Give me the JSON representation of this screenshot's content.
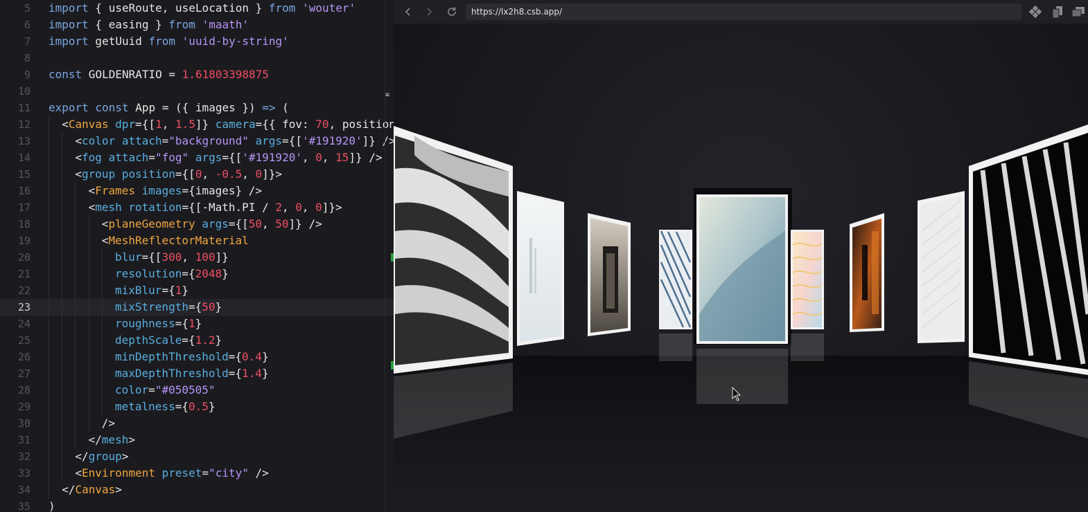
{
  "editor": {
    "current_line": 23,
    "lines": [
      {
        "n": 5,
        "indent": 0,
        "tokens": [
          [
            "k",
            "import"
          ],
          [
            "p",
            " { useRoute, useLocation } "
          ],
          [
            "k",
            "from"
          ],
          [
            "p",
            " "
          ],
          [
            "s",
            "'wouter'"
          ]
        ]
      },
      {
        "n": 6,
        "indent": 0,
        "tokens": [
          [
            "k",
            "import"
          ],
          [
            "p",
            " { easing } "
          ],
          [
            "k",
            "from"
          ],
          [
            "p",
            " "
          ],
          [
            "s",
            "'maath'"
          ]
        ]
      },
      {
        "n": 7,
        "indent": 0,
        "tokens": [
          [
            "k",
            "import"
          ],
          [
            "p",
            " getUuid "
          ],
          [
            "k",
            "from"
          ],
          [
            "p",
            " "
          ],
          [
            "s",
            "'uuid-by-string'"
          ]
        ]
      },
      {
        "n": 8,
        "indent": 0,
        "tokens": []
      },
      {
        "n": 9,
        "indent": 0,
        "tokens": [
          [
            "k",
            "const"
          ],
          [
            "p",
            " GOLDENRATIO = "
          ],
          [
            "n",
            "1.61803398875"
          ]
        ]
      },
      {
        "n": 10,
        "indent": 0,
        "tokens": []
      },
      {
        "n": 11,
        "indent": 0,
        "tokens": [
          [
            "k",
            "export const"
          ],
          [
            "p",
            " App = ({ images }) "
          ],
          [
            "k",
            "=>"
          ],
          [
            "p",
            " ("
          ]
        ]
      },
      {
        "n": 12,
        "indent": 1,
        "tokens": [
          [
            "p",
            "<"
          ],
          [
            "t",
            "Canvas"
          ],
          [
            "p",
            " "
          ],
          [
            "a",
            "dpr"
          ],
          [
            "p",
            "={["
          ],
          [
            "n",
            "1"
          ],
          [
            "p",
            ", "
          ],
          [
            "n",
            "1.5"
          ],
          [
            "p",
            "]} "
          ],
          [
            "a",
            "camera"
          ],
          [
            "p",
            "={{ fov: "
          ],
          [
            "n",
            "70"
          ],
          [
            "p",
            ", position"
          ]
        ]
      },
      {
        "n": 13,
        "indent": 2,
        "tokens": [
          [
            "p",
            "<"
          ],
          [
            "a",
            "color"
          ],
          [
            "p",
            " "
          ],
          [
            "a",
            "attach"
          ],
          [
            "p",
            "="
          ],
          [
            "s",
            "\"background\""
          ],
          [
            "p",
            " "
          ],
          [
            "a",
            "args"
          ],
          [
            "p",
            "={["
          ],
          [
            "s",
            "'#191920'"
          ],
          [
            "p",
            "]} />"
          ]
        ]
      },
      {
        "n": 14,
        "indent": 2,
        "tokens": [
          [
            "p",
            "<"
          ],
          [
            "a",
            "fog"
          ],
          [
            "p",
            " "
          ],
          [
            "a",
            "attach"
          ],
          [
            "p",
            "="
          ],
          [
            "s",
            "\"fog\""
          ],
          [
            "p",
            " "
          ],
          [
            "a",
            "args"
          ],
          [
            "p",
            "={["
          ],
          [
            "s",
            "'#191920'"
          ],
          [
            "p",
            ", "
          ],
          [
            "n",
            "0"
          ],
          [
            "p",
            ", "
          ],
          [
            "n",
            "15"
          ],
          [
            "p",
            "]} />"
          ]
        ]
      },
      {
        "n": 15,
        "indent": 2,
        "tokens": [
          [
            "p",
            "<"
          ],
          [
            "a",
            "group"
          ],
          [
            "p",
            " "
          ],
          [
            "a",
            "position"
          ],
          [
            "p",
            "={["
          ],
          [
            "n",
            "0"
          ],
          [
            "p",
            ", "
          ],
          [
            "n",
            "-0.5"
          ],
          [
            "p",
            ", "
          ],
          [
            "n",
            "0"
          ],
          [
            "p",
            "]}>"
          ]
        ]
      },
      {
        "n": 16,
        "indent": 3,
        "tokens": [
          [
            "p",
            "<"
          ],
          [
            "t",
            "Frames"
          ],
          [
            "p",
            " "
          ],
          [
            "a",
            "images"
          ],
          [
            "p",
            "={images} />"
          ]
        ]
      },
      {
        "n": 17,
        "indent": 3,
        "tokens": [
          [
            "p",
            "<"
          ],
          [
            "a",
            "mesh"
          ],
          [
            "p",
            " "
          ],
          [
            "a",
            "rotation"
          ],
          [
            "p",
            "={[-Math.PI / "
          ],
          [
            "n",
            "2"
          ],
          [
            "p",
            ", "
          ],
          [
            "n",
            "0"
          ],
          [
            "p",
            ", "
          ],
          [
            "n",
            "0"
          ],
          [
            "p",
            "]}>"
          ]
        ]
      },
      {
        "n": 18,
        "indent": 4,
        "tokens": [
          [
            "p",
            "<"
          ],
          [
            "t",
            "planeGeometry"
          ],
          [
            "p",
            " "
          ],
          [
            "a",
            "args"
          ],
          [
            "p",
            "={["
          ],
          [
            "n",
            "50"
          ],
          [
            "p",
            ", "
          ],
          [
            "n",
            "50"
          ],
          [
            "p",
            "]} />"
          ]
        ]
      },
      {
        "n": 19,
        "indent": 4,
        "tokens": [
          [
            "p",
            "<"
          ],
          [
            "t",
            "MeshReflectorMaterial"
          ]
        ]
      },
      {
        "n": 20,
        "indent": 5,
        "tokens": [
          [
            "a",
            "blur"
          ],
          [
            "p",
            "={["
          ],
          [
            "n",
            "300"
          ],
          [
            "p",
            ", "
          ],
          [
            "n",
            "100"
          ],
          [
            "p",
            "]}"
          ]
        ]
      },
      {
        "n": 21,
        "indent": 5,
        "tokens": [
          [
            "a",
            "resolution"
          ],
          [
            "p",
            "={"
          ],
          [
            "n",
            "2048"
          ],
          [
            "p",
            "}"
          ]
        ]
      },
      {
        "n": 22,
        "indent": 5,
        "tokens": [
          [
            "a",
            "mixBlur"
          ],
          [
            "p",
            "={"
          ],
          [
            "n",
            "1"
          ],
          [
            "p",
            "}"
          ]
        ]
      },
      {
        "n": 23,
        "indent": 5,
        "tokens": [
          [
            "a",
            "mixStrength"
          ],
          [
            "p",
            "={"
          ],
          [
            "n",
            "50"
          ],
          [
            "p",
            "}"
          ]
        ]
      },
      {
        "n": 24,
        "indent": 5,
        "tokens": [
          [
            "a",
            "roughness"
          ],
          [
            "p",
            "={"
          ],
          [
            "n",
            "1"
          ],
          [
            "p",
            "}"
          ]
        ]
      },
      {
        "n": 25,
        "indent": 5,
        "tokens": [
          [
            "a",
            "depthScale"
          ],
          [
            "p",
            "={"
          ],
          [
            "n",
            "1.2"
          ],
          [
            "p",
            "}"
          ]
        ]
      },
      {
        "n": 26,
        "indent": 5,
        "tokens": [
          [
            "a",
            "minDepthThreshold"
          ],
          [
            "p",
            "={"
          ],
          [
            "n",
            "0.4"
          ],
          [
            "p",
            "}"
          ]
        ]
      },
      {
        "n": 27,
        "indent": 5,
        "tokens": [
          [
            "a",
            "maxDepthThreshold"
          ],
          [
            "p",
            "={"
          ],
          [
            "n",
            "1.4"
          ],
          [
            "p",
            "}"
          ]
        ]
      },
      {
        "n": 28,
        "indent": 5,
        "tokens": [
          [
            "a",
            "color"
          ],
          [
            "p",
            "="
          ],
          [
            "s",
            "\"#050505\""
          ]
        ]
      },
      {
        "n": 29,
        "indent": 5,
        "tokens": [
          [
            "a",
            "metalness"
          ],
          [
            "p",
            "={"
          ],
          [
            "n",
            "0.5"
          ],
          [
            "p",
            "}"
          ]
        ]
      },
      {
        "n": 30,
        "indent": 4,
        "tokens": [
          [
            "p",
            "/>"
          ]
        ]
      },
      {
        "n": 31,
        "indent": 3,
        "tokens": [
          [
            "p",
            "</"
          ],
          [
            "a",
            "mesh"
          ],
          [
            "p",
            ">"
          ]
        ]
      },
      {
        "n": 32,
        "indent": 2,
        "tokens": [
          [
            "p",
            "</"
          ],
          [
            "a",
            "group"
          ],
          [
            "p",
            ">"
          ]
        ]
      },
      {
        "n": 33,
        "indent": 2,
        "tokens": [
          [
            "p",
            "<"
          ],
          [
            "t",
            "Environment"
          ],
          [
            "p",
            " "
          ],
          [
            "a",
            "preset"
          ],
          [
            "p",
            "="
          ],
          [
            "s",
            "\"city\""
          ],
          [
            "p",
            " />"
          ]
        ]
      },
      {
        "n": 34,
        "indent": 1,
        "tokens": [
          [
            "p",
            "</"
          ],
          [
            "t",
            "Canvas"
          ],
          [
            "p",
            ">"
          ]
        ]
      },
      {
        "n": 35,
        "indent": 0,
        "tokens": [
          [
            "p",
            ")"
          ]
        ]
      }
    ]
  },
  "browser": {
    "url": "https://lx2h8.csb.app/",
    "icons": {
      "back": "chevron-left-icon",
      "forward": "chevron-right-icon",
      "reload": "reload-icon",
      "extension": "codesandbox-icon",
      "pages": "copy-pages-icon",
      "window": "open-window-icon"
    }
  },
  "gallery": {
    "background_color": "#191920",
    "frame_color": "#f2f2f2",
    "frames": [
      {
        "id": "architecture-curves",
        "colors": [
          "#d8d8d8",
          "#3a3a3a",
          "#9a9a9a"
        ]
      },
      {
        "id": "foggy-tower",
        "colors": [
          "#e9eef0",
          "#b7c4c9",
          "#ffffff"
        ]
      },
      {
        "id": "dark-doorway",
        "colors": [
          "#cfc5b9",
          "#2a2824",
          "#7d776d"
        ]
      },
      {
        "id": "blue-stripes",
        "colors": [
          "#e8eef2",
          "#4f6e8f",
          "#ffffff"
        ]
      },
      {
        "id": "teal-curve",
        "colors": [
          "#d9dfd2",
          "#8eb0bd",
          "#5e8598"
        ]
      },
      {
        "id": "pastel-waves",
        "colors": [
          "#f4e7c9",
          "#9ec7e0",
          "#f1b7b0"
        ]
      },
      {
        "id": "orange-interior",
        "colors": [
          "#2a1a12",
          "#c0601e",
          "#6b3518"
        ]
      },
      {
        "id": "light-stripes",
        "colors": [
          "#f3f3f3",
          "#cfcfcf",
          "#ffffff"
        ]
      },
      {
        "id": "black-columns",
        "colors": [
          "#050505",
          "#d9d9d9",
          "#1a1a1a"
        ]
      }
    ]
  }
}
